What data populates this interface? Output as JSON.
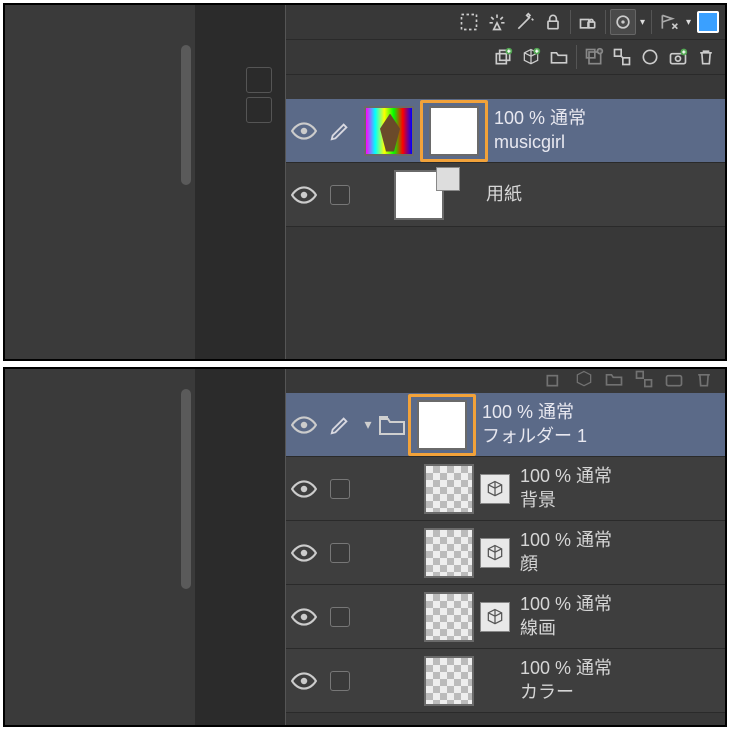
{
  "panel1": {
    "toolbar_row1_icons": [
      "select-dashed-icon",
      "light-icon",
      "wand-icon",
      "lock-icon",
      "mask-lock-icon",
      "fx-circle-icon",
      "flag-x-icon",
      "color-swatch"
    ],
    "toolbar_row2_icons": [
      "stack-add-icon",
      "cube-add-icon",
      "folder-icon",
      "overlay-add-icon",
      "merge-icon",
      "circle-icon",
      "camera-add-icon",
      "trash-icon"
    ],
    "left_slots_icons": [
      "slots-top-icon",
      "slots-bottom-icon"
    ],
    "layers": [
      {
        "selected": true,
        "opacity_label": "100 % 通常",
        "name": "musicgirl",
        "thumb_kind": "rainbow",
        "mask_highlight": true
      },
      {
        "selected": false,
        "opacity_label": "",
        "name": "用紙",
        "thumb_kind": "white",
        "mask_mini": true
      }
    ]
  },
  "panel2": {
    "folder": {
      "selected": true,
      "mask_highlight": true,
      "opacity_label": "100 % 通常",
      "name": "フォルダー 1"
    },
    "children": [
      {
        "opacity_label": "100 % 通常",
        "name": "背景",
        "cube": true
      },
      {
        "opacity_label": "100 % 通常",
        "name": "顔",
        "cube": true
      },
      {
        "opacity_label": "100 % 通常",
        "name": "線画",
        "cube": true
      },
      {
        "opacity_label": "100 % 通常",
        "name": "カラー",
        "cube": false
      }
    ]
  }
}
